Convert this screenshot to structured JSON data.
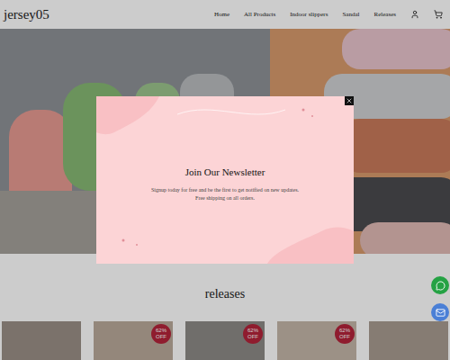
{
  "header": {
    "logo": "jersey05",
    "nav": [
      {
        "label": "Home"
      },
      {
        "label": "All Products"
      },
      {
        "label": "Indoor slippers"
      },
      {
        "label": "Sandal"
      },
      {
        "label": "Releases"
      }
    ]
  },
  "newsletter": {
    "title": "Join Our Newsletter",
    "lines": [
      "Signup today for free and be the first to get notified on new updates.",
      "Free shipping on all orders."
    ]
  },
  "section": {
    "title": "releases"
  },
  "products": [
    {
      "discounted": false,
      "color": "#9a8f86"
    },
    {
      "discounted": true,
      "badge": "62% OFF",
      "color": "#b9a99a"
    },
    {
      "discounted": true,
      "badge": "62% OFF",
      "color": "#8c8a86"
    },
    {
      "discounted": true,
      "badge": "62% OFF",
      "color": "#c4b6a8"
    },
    {
      "discounted": false,
      "color": "#a89c90"
    }
  ]
}
